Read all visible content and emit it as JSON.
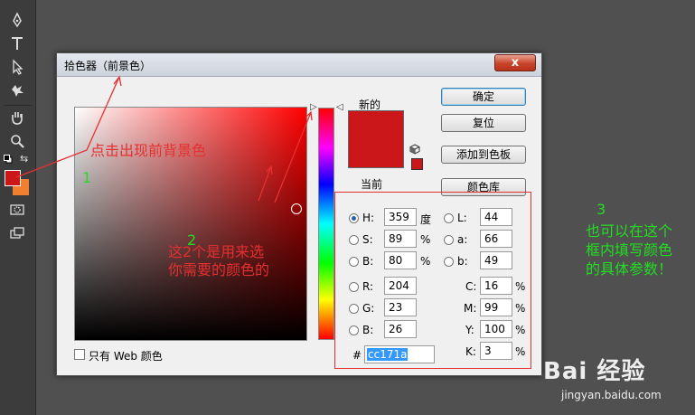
{
  "toolbar": {
    "tools": [
      "pen-tool",
      "type-tool",
      "path-selection-tool",
      "custom-shape-tool",
      "hand-tool",
      "zoom-tool"
    ],
    "foreground_color": "#cc171a",
    "background_color": "#f08030"
  },
  "dialog": {
    "title": "拾色器（前景色）",
    "close_label": "x",
    "new_label": "新的",
    "current_label": "当前",
    "new_color": "#cc171a",
    "current_color": "#cc171a",
    "buttons": {
      "ok": "确定",
      "reset": "复位",
      "add_to_swatches": "添加到色板",
      "color_libraries": "颜色库"
    },
    "web_only_label": "只有 Web 颜色",
    "hsb": [
      {
        "label": "H:",
        "value": "359",
        "unit": "度",
        "selected": true
      },
      {
        "label": "S:",
        "value": "89",
        "unit": "%",
        "selected": false
      },
      {
        "label": "B:",
        "value": "80",
        "unit": "%",
        "selected": false
      }
    ],
    "lab": [
      {
        "label": "L:",
        "value": "44"
      },
      {
        "label": "a:",
        "value": "66"
      },
      {
        "label": "b:",
        "value": "49"
      }
    ],
    "rgb": [
      {
        "label": "R:",
        "value": "204"
      },
      {
        "label": "G:",
        "value": "23"
      },
      {
        "label": "B:",
        "value": "26"
      }
    ],
    "cmyk": [
      {
        "label": "C:",
        "value": "16",
        "unit": "%"
      },
      {
        "label": "M:",
        "value": "99",
        "unit": "%"
      },
      {
        "label": "Y:",
        "value": "100",
        "unit": "%"
      },
      {
        "label": "K:",
        "value": "3",
        "unit": "%"
      }
    ],
    "hex_label": "#",
    "hex_value": "cc171a"
  },
  "annotations": {
    "step1_num": "1",
    "step1_text": "点击出现前背景色",
    "step2_num": "2",
    "step2_line1": "这2个是用来选",
    "step2_line2": "你需要的颜色的",
    "step3_num": "3",
    "step3_line1": "也可以在这个",
    "step3_line2": "框内填写颜色",
    "step3_line3": "的具体参数！",
    "red": "#e53030",
    "green": "#22dd22"
  },
  "watermark": {
    "logo": "Bai 经验",
    "url": "jingyan.baidu.com"
  }
}
